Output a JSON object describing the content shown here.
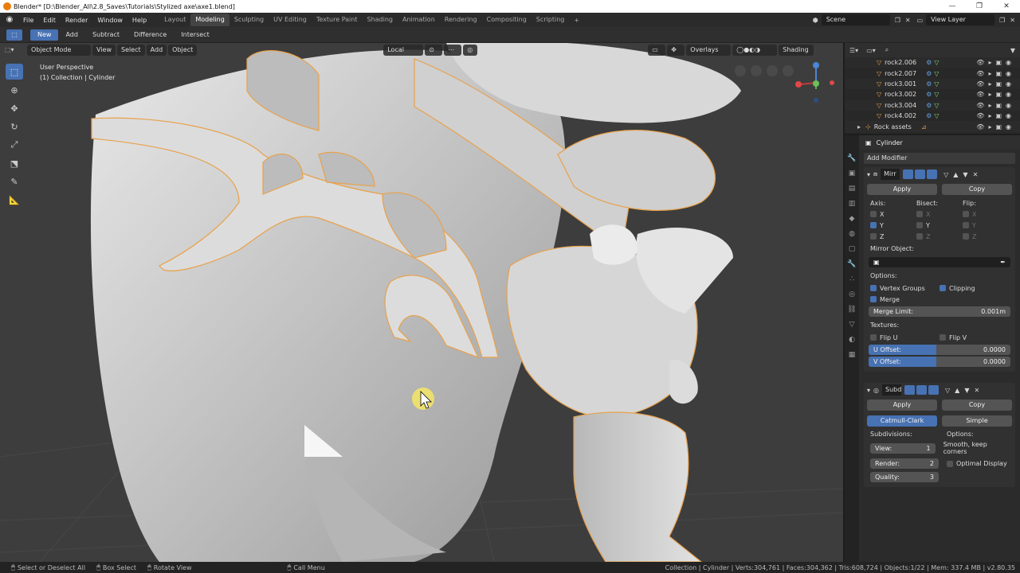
{
  "window": {
    "title": "Blender* [D:\\Blender_All\\2.8_Saves\\Tutorials\\Stylized axe\\axe1.blend]"
  },
  "menu": [
    "File",
    "Edit",
    "Render",
    "Window",
    "Help"
  ],
  "workspaces": [
    "Layout",
    "Modeling",
    "Sculpting",
    "UV Editing",
    "Texture Paint",
    "Shading",
    "Animation",
    "Rendering",
    "Compositing",
    "Scripting"
  ],
  "active_workspace": "Modeling",
  "scene": "Scene",
  "view_layer": "View Layer",
  "tool_header": {
    "items": [
      "New",
      "Add",
      "Subtract",
      "Difference",
      "Intersect"
    ]
  },
  "viewport": {
    "mode": "Object Mode",
    "menus": [
      "View",
      "Select",
      "Add",
      "Object"
    ],
    "orientation": "Local",
    "overlays": "Overlays",
    "shading": "Shading",
    "info_line1": "User Perspective",
    "info_line2": "(1) Collection | Cylinder"
  },
  "outliner": {
    "rows": [
      {
        "name": "rock2.006"
      },
      {
        "name": "rock2.007"
      },
      {
        "name": "rock3.001"
      },
      {
        "name": "rock3.002"
      },
      {
        "name": "rock3.004"
      },
      {
        "name": "rock4.002"
      },
      {
        "name": "Rock assets"
      }
    ]
  },
  "properties": {
    "object": "Cylinder",
    "add_modifier": "Add Modifier",
    "mirror": {
      "name": "Mirr",
      "apply": "Apply",
      "copy": "Copy",
      "axis_label": "Axis:",
      "bisect_label": "Bisect:",
      "flip_label": "Flip:",
      "axes": [
        "X",
        "Y",
        "Z"
      ],
      "mirror_object_label": "Mirror Object:",
      "options_label": "Options:",
      "vertex_groups": "Vertex Groups",
      "clipping": "Clipping",
      "merge": "Merge",
      "merge_limit_label": "Merge Limit:",
      "merge_limit_value": "0.001m",
      "textures_label": "Textures:",
      "flip_u": "Flip U",
      "flip_v": "Flip V",
      "u_offset_label": "U Offset:",
      "u_offset_value": "0.0000",
      "v_offset_label": "V Offset:",
      "v_offset_value": "0.0000"
    },
    "subsurf": {
      "name": "Subd",
      "apply": "Apply",
      "copy": "Copy",
      "catmull": "Catmull-Clark",
      "simple": "Simple",
      "subdivisions_label": "Subdivisions:",
      "options_label": "Options:",
      "view_label": "View:",
      "view_value": "1",
      "render_label": "Render:",
      "render_value": "2",
      "quality_label": "Quality:",
      "quality_value": "3",
      "uv_smooth": "Smooth, keep corners",
      "optimal_display": "Optimal Display"
    }
  },
  "status": {
    "select": "Select or Deselect All",
    "box_select": "Box Select",
    "rotate": "Rotate View",
    "call_menu": "Call Menu",
    "stats": "Collection | Cylinder | Verts:304,761 | Faces:304,362 | Tris:608,724 | Objects:1/22 | Mem: 337.4 MB | v2.80.35"
  },
  "colors": {
    "accent": "#4772b3",
    "outline": "#e8a14a",
    "background": "#3d3d3d"
  }
}
